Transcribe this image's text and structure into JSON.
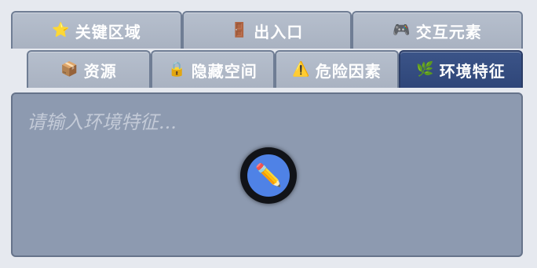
{
  "tabs_row1": [
    {
      "id": "key-areas",
      "label": "关键区域",
      "icon": "star-icon",
      "glyph": "⭐"
    },
    {
      "id": "entrances",
      "label": "出入口",
      "icon": "door-icon",
      "glyph": "🚪"
    },
    {
      "id": "interactive",
      "label": "交互元素",
      "icon": "gamepad-icon",
      "glyph": "🎮"
    }
  ],
  "tabs_row2": [
    {
      "id": "resources",
      "label": "资源",
      "icon": "package-icon",
      "glyph": "📦"
    },
    {
      "id": "hidden-space",
      "label": "隐藏空间",
      "icon": "lock-icon",
      "glyph": "🔒"
    },
    {
      "id": "hazards",
      "label": "危险因素",
      "icon": "warning-icon",
      "glyph": "⚠️"
    },
    {
      "id": "environment",
      "label": "环境特征",
      "icon": "herb-icon",
      "glyph": "🌿",
      "active": true
    }
  ],
  "editor": {
    "placeholder": "请输入环境特征..."
  },
  "fab": {
    "icon": "pencil-icon",
    "glyph": "✏️"
  },
  "colors": {
    "active_tab": "#2f4679",
    "inactive_tab": "#aeb7c6",
    "content_bg": "#8d9ab0",
    "fab_accent": "#4f82e6"
  }
}
